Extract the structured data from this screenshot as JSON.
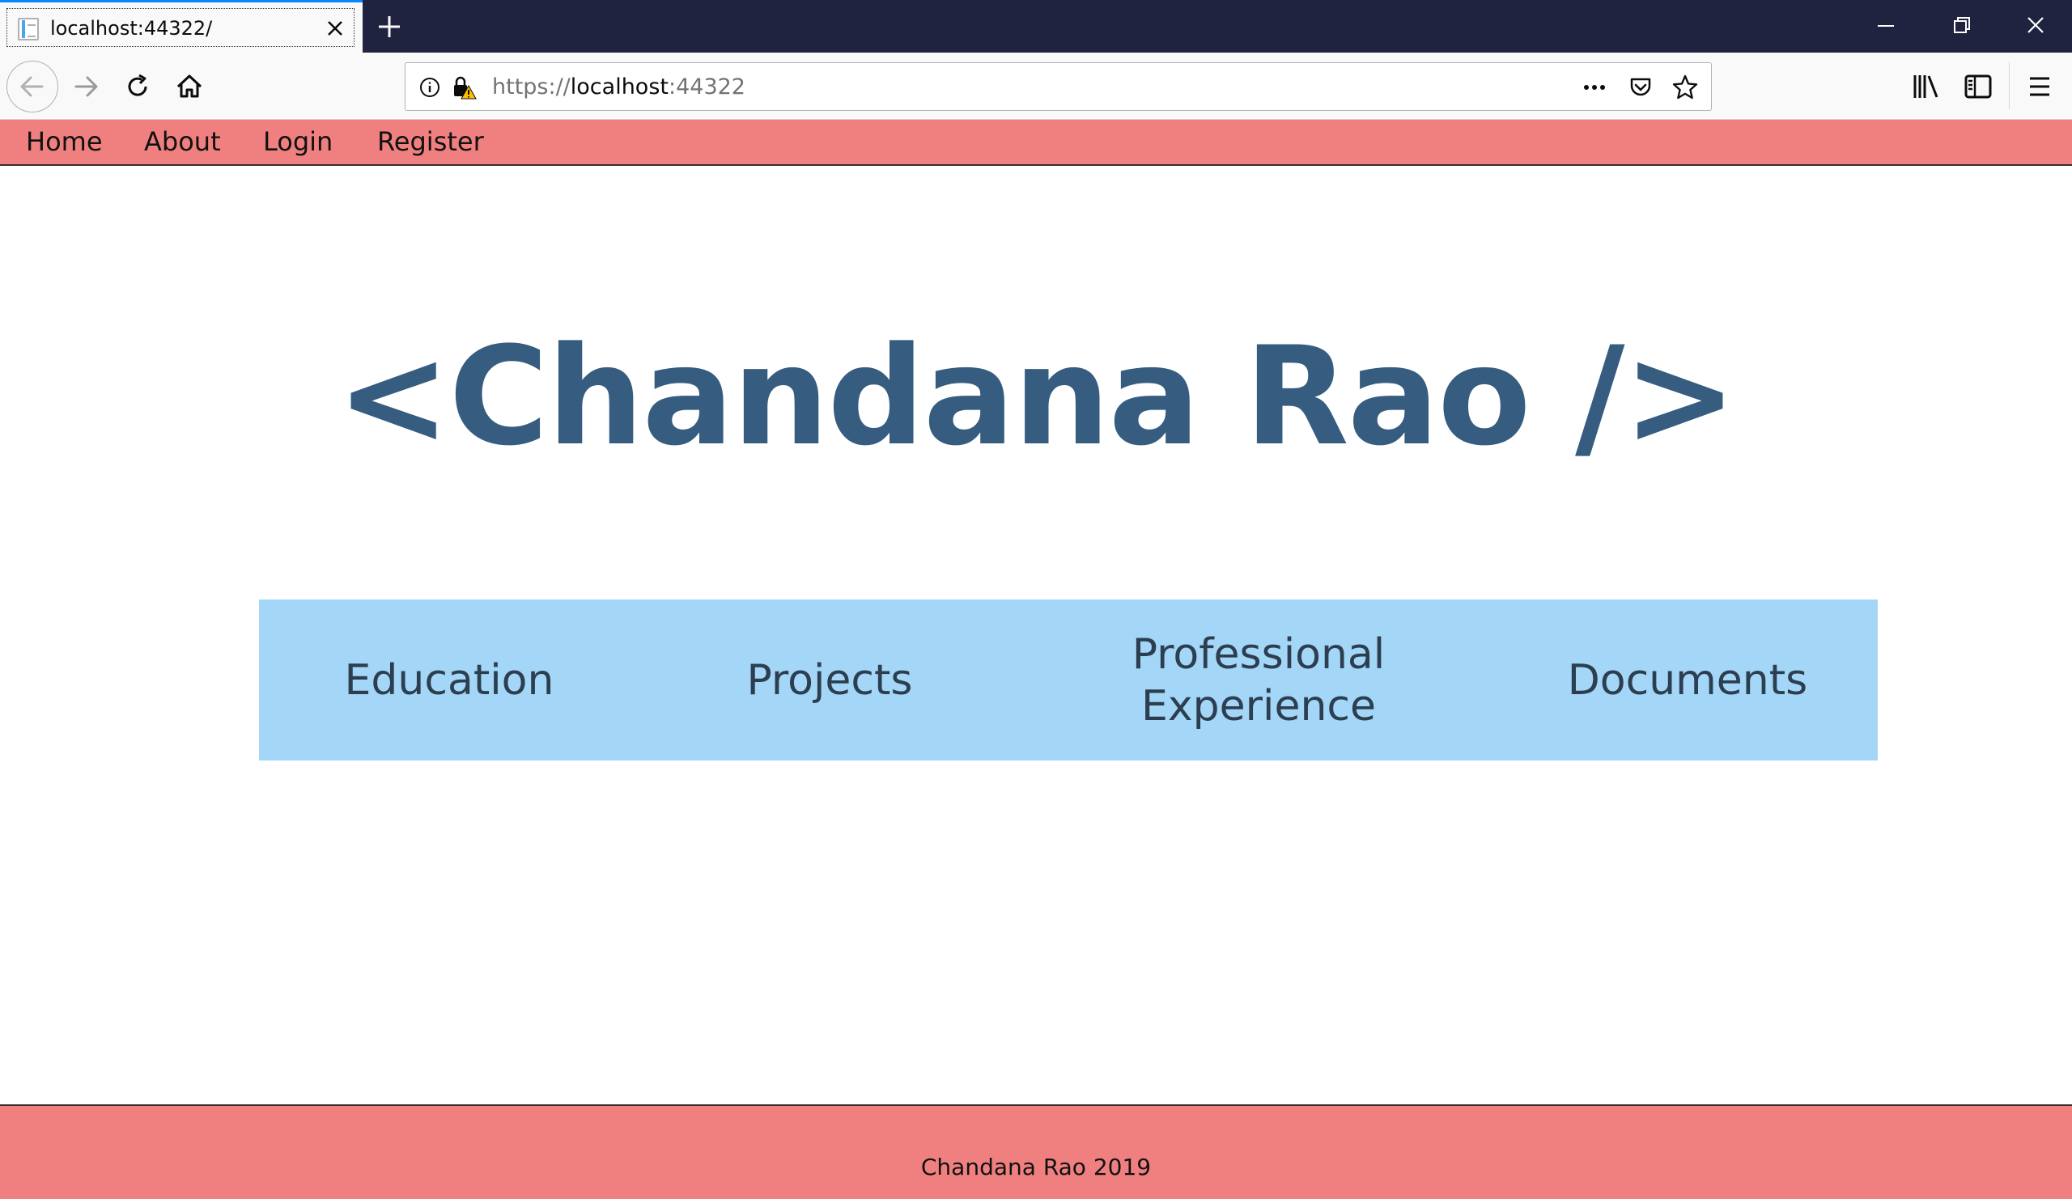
{
  "browser": {
    "tab_title": "localhost:44322/",
    "url_scheme": "https://",
    "url_host": "localhost",
    "url_port": ":44322"
  },
  "site_nav": {
    "items": [
      {
        "label": "Home"
      },
      {
        "label": "About"
      },
      {
        "label": "Login"
      },
      {
        "label": "Register"
      }
    ]
  },
  "hero": {
    "title": "<Chandana Rao />"
  },
  "cards": [
    {
      "label": "Education"
    },
    {
      "label": "Projects"
    },
    {
      "label": "Professional Experience"
    },
    {
      "label": "Documents"
    }
  ],
  "footer": {
    "text": "Chandana Rao 2019"
  },
  "colors": {
    "nav_bg": "#f08080",
    "hero_text": "#365d80",
    "cards_bg": "#a3d6f7",
    "tabbar_bg": "#202340"
  }
}
